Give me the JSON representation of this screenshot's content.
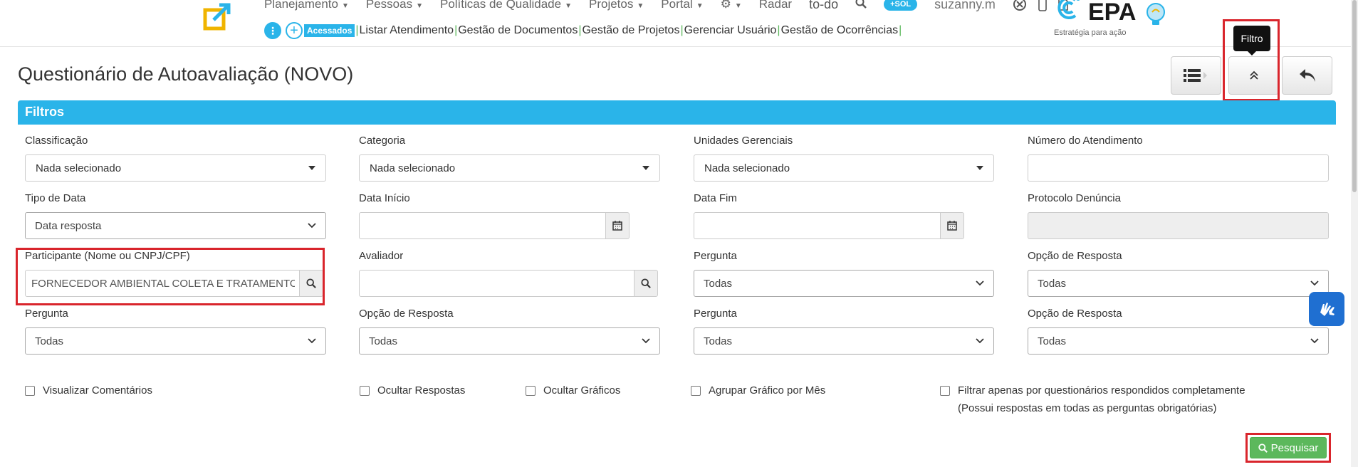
{
  "nav": {
    "row1": [
      "Planejamento",
      "Pessoas",
      "Políticas de Qualidade",
      "Projetos",
      "Portal"
    ],
    "radar": "Radar",
    "todo": "to-do",
    "sol": "+SOL",
    "user": "suzanny.m"
  },
  "nav2": {
    "acessados": "Acessados",
    "links": [
      "Listar Atendimento",
      "Gestão de Documentos",
      "Gestão de Projetos",
      "Gerenciar Usuário",
      "Gestão de Ocorrências"
    ]
  },
  "brand": {
    "name": "EPA",
    "tagline": "Estratégia para ação"
  },
  "page": {
    "title": "Questionário de Autoavaliação (NOVO)",
    "tooltip": "Filtro"
  },
  "panel": {
    "title": "Filtros"
  },
  "fields": {
    "classificacao": {
      "label": "Classificação",
      "value": "Nada selecionado"
    },
    "categoria": {
      "label": "Categoria",
      "value": "Nada selecionado"
    },
    "unidades": {
      "label": "Unidades Gerenciais",
      "value": "Nada selecionado"
    },
    "numero": {
      "label": "Número do Atendimento",
      "value": ""
    },
    "tipo_data": {
      "label": "Tipo de Data",
      "value": "Data resposta"
    },
    "data_inicio": {
      "label": "Data Início",
      "value": ""
    },
    "data_fim": {
      "label": "Data Fim",
      "value": ""
    },
    "protocolo": {
      "label": "Protocolo Denúncia",
      "value": ""
    },
    "participante": {
      "label": "Participante (Nome ou CNPJ/CPF)",
      "value": "FORNECEDOR AMBIENTAL COLETA E TRATAMENTO"
    },
    "avaliador": {
      "label": "Avaliador",
      "value": ""
    },
    "pergunta1": {
      "label": "Pergunta",
      "value": "Todas"
    },
    "opcao1": {
      "label": "Opção de Resposta",
      "value": "Todas"
    },
    "pergunta2": {
      "label": "Pergunta",
      "value": "Todas"
    },
    "opcao2": {
      "label": "Opção de Resposta",
      "value": "Todas"
    },
    "pergunta3": {
      "label": "Pergunta",
      "value": "Todas"
    },
    "opcao3": {
      "label": "Opção de Resposta",
      "value": "Todas"
    }
  },
  "checks": {
    "comentarios": "Visualizar Comentários",
    "ocultar_respostas": "Ocultar Respostas",
    "ocultar_graficos": "Ocultar Gráficos",
    "agrupar": "Agrupar Gráfico por Mês",
    "filtrar": "Filtrar apenas por questionários respondidos completamente (Possui respostas em todas as perguntas obrigatórias)"
  },
  "buttons": {
    "pesquisar": "Pesquisar"
  },
  "colors": {
    "accent": "#2ab4e9",
    "success": "#5cb85c",
    "highlight": "#d9252c"
  }
}
